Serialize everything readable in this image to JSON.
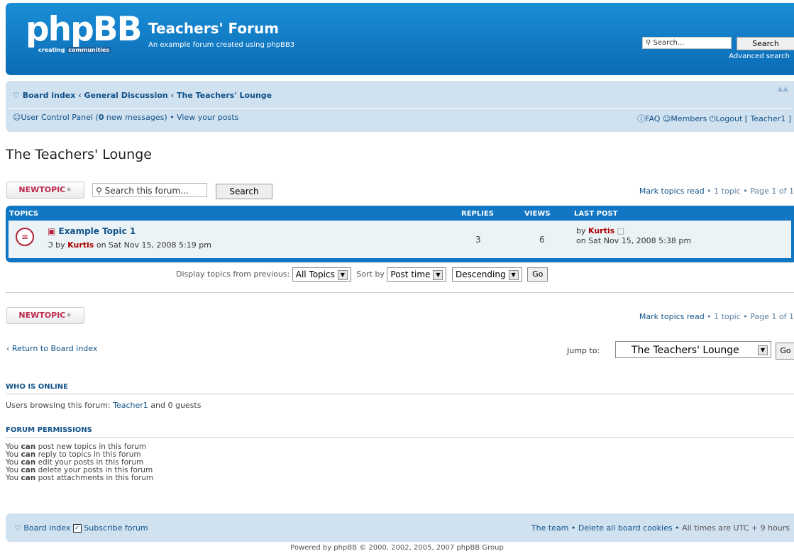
{
  "header": {
    "logo_main": "phpBB",
    "logo_sub_1": "creating",
    "logo_sub_2": "communities",
    "site_title": "Teachers' Forum",
    "site_desc": "An example forum created using phpBB3",
    "search_placeholder": "Search...",
    "search_button": "Search",
    "advanced_search": "Advanced search"
  },
  "navbar": {
    "crumb_board": "Board index",
    "crumb_sep": "‹",
    "crumb_general": "General Discussion",
    "crumb_lounge": "The Teachers' Lounge",
    "ucp_prefix": "User Control Panel (",
    "ucp_count": "0",
    "ucp_suffix": " new messages)",
    "view_posts": "View your posts",
    "faq": "FAQ",
    "members": "Members",
    "logout": "Logout [ Teacher1 ]"
  },
  "page": {
    "title": "The Teachers' Lounge",
    "new_topic": "NEWTOPIC",
    "forum_search_placeholder": "Search this forum...",
    "forum_search_button": "Search",
    "mark_read": "Mark topics read",
    "topic_count": "1 topic",
    "page_info": "Page 1 of 1"
  },
  "topics": {
    "headers": {
      "topics": "TOPICS",
      "replies": "REPLIES",
      "views": "VIEWS",
      "last_post": "LAST POST"
    },
    "rows": [
      {
        "title": "Example Topic 1",
        "by": "by",
        "author": "Kurtis",
        "date": "on Sat Nov 15, 2008 5:19 pm",
        "replies": "3",
        "views": "6",
        "last_by": "by",
        "last_author": "Kurtis",
        "last_date": "on Sat Nov 15, 2008 5:38 pm"
      }
    ]
  },
  "display": {
    "label": "Display topics from previous:",
    "from_value": "All Topics",
    "sort_label": "Sort by",
    "sort_value": "Post time",
    "order_value": "Descending",
    "go": "Go"
  },
  "bottom": {
    "return_link": "Return to Board index",
    "jump_label": "Jump to:",
    "jump_value": "The Teachers' Lounge",
    "jump_go": "Go"
  },
  "online": {
    "heading": "WHO IS ONLINE",
    "text_prefix": "Users browsing this forum: ",
    "user": "Teacher1",
    "text_suffix": " and 0 guests"
  },
  "permissions": {
    "heading": "FORUM PERMISSIONS",
    "you": "You",
    "can": "can",
    "items": [
      "post new topics in this forum",
      "reply to topics in this forum",
      "edit your posts in this forum",
      "delete your posts in this forum",
      "post attachments in this forum"
    ]
  },
  "footer": {
    "board_index": "Board index",
    "subscribe": "Subscribe forum",
    "team": "The team",
    "delete_cookies": "Delete all board cookies",
    "timezone": "All times are UTC + 9 hours",
    "copyright": "Powered by phpBB © 2000, 2002, 2005, 2007 phpBB Group"
  }
}
